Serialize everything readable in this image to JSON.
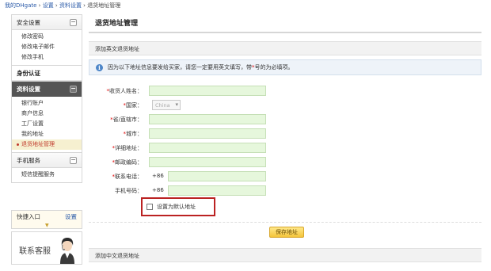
{
  "breadcrumb": {
    "home": "我的DHgate",
    "sep": " › ",
    "settings": "设置",
    "profile": "资料设置",
    "current": "退货地址管理"
  },
  "sidebar": {
    "security": {
      "title": "安全设置",
      "items": [
        "修改密码",
        "修改电子邮件",
        "修改手机"
      ]
    },
    "identity": {
      "title": "身份认证"
    },
    "profile": {
      "title": "资料设置",
      "items": [
        "银行账户",
        "商户信息",
        "工厂设置",
        "我的地址",
        "退货地址管理"
      ]
    },
    "mobile": {
      "title": "手机服务",
      "items": [
        "短信提醒服务"
      ]
    },
    "toggle_minus": "−",
    "quick_entry": {
      "label": "快捷入口",
      "link": "设置"
    },
    "customer_service": "联系客服"
  },
  "main": {
    "title": "退货地址管理",
    "section_en": "添加英文退货地址",
    "notice_pre": "因为以下地址信息要发给买家，请您一定要用英文填写，带",
    "notice_star": "*",
    "notice_post": "号的为必填项。",
    "info_glyph": "i",
    "required_mark": "*",
    "form": {
      "name_label": "收货人姓名：",
      "country_label": "国家：",
      "country_value": "China",
      "country_caret": "▾",
      "province_label": "省/直辖市：",
      "city_label": "城市：",
      "address_label": "详细地址：",
      "zip_label": "邮政编码：",
      "phone_label": "联系电话：",
      "phone_prefix": "+86",
      "mobile_label": "手机号码：",
      "mobile_prefix": "+86",
      "default_label": "设置为默认地址"
    },
    "save_button": "保存地址",
    "section_cn": "添加中文退货地址"
  },
  "colors": {
    "field_bg": "#e6f7dc",
    "highlight_border": "#b22222",
    "save_button": "#f4c43b",
    "sidebar_active": "#555555"
  }
}
